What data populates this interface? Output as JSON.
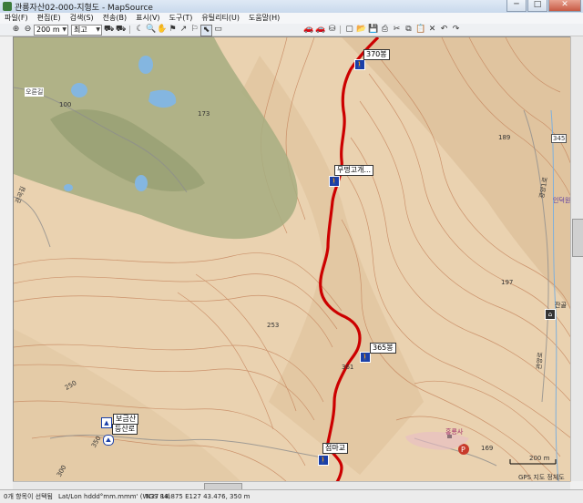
{
  "window": {
    "title": "관룡자산02-000-지형도 - MapSource",
    "buttons": {
      "minimize": "─",
      "maximize": "□",
      "close": "✕"
    }
  },
  "menu": [
    "파일(F)",
    "편집(E)",
    "검색(S)",
    "전송(B)",
    "표시(V)",
    "도구(T)",
    "유틸리티(U)",
    "도움말(H)"
  ],
  "toolbar": {
    "zoom_level": "200 m",
    "detail_level": "최고"
  },
  "waypoints": [
    {
      "label": "370봉",
      "kind": "hiker"
    },
    {
      "label": "무명고개...",
      "kind": "hiker"
    },
    {
      "label": "365봉",
      "kind": "hiker"
    },
    {
      "label": "점마교",
      "kind": "hiker"
    },
    {
      "label": "보금산",
      "kind": "summit"
    },
    {
      "label": "등산로",
      "kind": "trail"
    }
  ],
  "map_labels": {
    "contours": [
      "100",
      "173",
      "189",
      "345",
      "197",
      "253",
      "361",
      "250",
      "350",
      "300",
      "169"
    ],
    "roads": [
      "오른길",
      "관곡길",
      "광양1로",
      "관양로"
    ],
    "places": [
      "인덕원",
      "잔골",
      "홍룡사"
    ],
    "scale_text": "200 m",
    "map_footer": "GPS 지도 정체도"
  },
  "status": {
    "left": "0개 항목이 선택됨",
    "format": "Lat/Lon hddd°mm.mmm' (WGS 84)",
    "coords": "N37 18.875 E127 43.476, 350 m"
  },
  "colors": {
    "map_land": "#ead2b0",
    "forest": "#a6ad80",
    "water": "#84b6e0",
    "track": "#cc0000",
    "contour": "#c4825a"
  }
}
